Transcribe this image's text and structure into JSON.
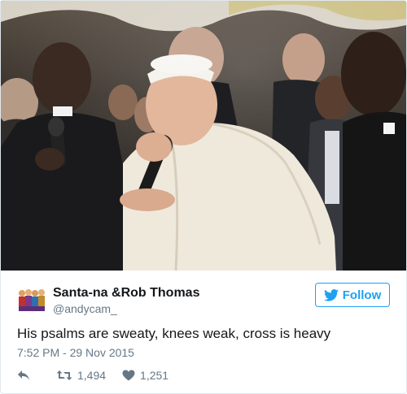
{
  "tweet": {
    "display_name": "Santa-na &Rob Thomas",
    "handle": "@andycam_",
    "text": "His psalms are sweaty, knees weak, cross is heavy",
    "timestamp": "7:52 PM - 29 Nov 2015",
    "retweets": "1,494",
    "likes": "1,251"
  },
  "follow_button": {
    "label": "Follow"
  },
  "colors": {
    "accent": "#1da1f2",
    "muted": "#657786",
    "text": "#14171a",
    "border": "#e1e8ed"
  },
  "icons": {
    "follow": "twitter-bird-icon",
    "reply": "reply-icon",
    "retweet": "retweet-icon",
    "like": "heart-icon"
  }
}
